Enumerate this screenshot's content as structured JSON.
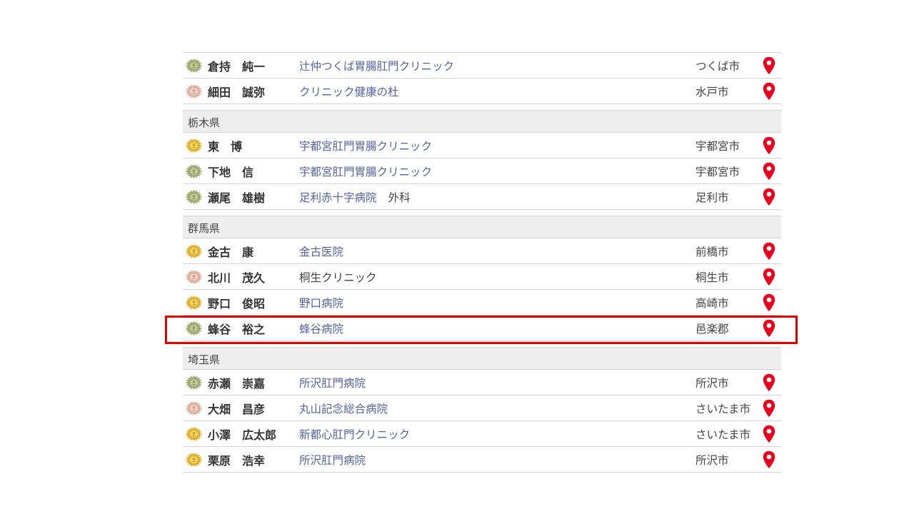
{
  "colors": {
    "link": "#5560a8",
    "text": "#333333",
    "section_bg": "#eeeeee",
    "pin": "#e8001c",
    "highlight_border": "#e00000",
    "badge_gold": "#e8b93c",
    "badge_olive": "#a8b07a",
    "badge_pink": "#e5b9a8"
  },
  "icons": {
    "badge": "member-seal-icon",
    "pin": "map-pin-icon"
  },
  "list": [
    {
      "type": "row",
      "badge": "olive",
      "name": "倉持　純一",
      "clinic": "辻仲つくば胃腸肛門クリニック",
      "clinic_link": true,
      "dept": "",
      "city": "つくば市"
    },
    {
      "type": "row",
      "badge": "pink",
      "name": "細田　誠弥",
      "clinic": "クリニック健康の杜",
      "clinic_link": true,
      "dept": "",
      "city": "水戸市"
    },
    {
      "type": "section",
      "label": "栃木県"
    },
    {
      "type": "row",
      "badge": "gold",
      "name": "東　博",
      "clinic": "宇都宮肛門胃腸クリニック",
      "clinic_link": true,
      "dept": "",
      "city": "宇都宮市"
    },
    {
      "type": "row",
      "badge": "olive",
      "name": "下地　信",
      "clinic": "宇都宮肛門胃腸クリニック",
      "clinic_link": true,
      "dept": "",
      "city": "宇都宮市"
    },
    {
      "type": "row",
      "badge": "olive",
      "name": "瀬尾　雄樹",
      "clinic": "足利赤十字病院",
      "clinic_link": true,
      "dept": "外科",
      "city": "足利市"
    },
    {
      "type": "section",
      "label": "群馬県"
    },
    {
      "type": "row",
      "badge": "gold",
      "name": "金古　康",
      "clinic": "金古医院",
      "clinic_link": true,
      "dept": "",
      "city": "前橋市"
    },
    {
      "type": "row",
      "badge": "pink",
      "name": "北川　茂久",
      "clinic": "桐生クリニック",
      "clinic_link": false,
      "dept": "",
      "city": "桐生市"
    },
    {
      "type": "row",
      "badge": "gold",
      "name": "野口　俊昭",
      "clinic": "野口病院",
      "clinic_link": true,
      "dept": "",
      "city": "高崎市"
    },
    {
      "type": "row",
      "badge": "olive",
      "name": "蜂谷　裕之",
      "clinic": "蜂谷病院",
      "clinic_link": true,
      "dept": "",
      "city": "邑楽郡",
      "highlighted": true
    },
    {
      "type": "section",
      "label": "埼玉県"
    },
    {
      "type": "row",
      "badge": "olive",
      "name": "赤瀬　崇嘉",
      "clinic": "所沢肛門病院",
      "clinic_link": true,
      "dept": "",
      "city": "所沢市"
    },
    {
      "type": "row",
      "badge": "pink",
      "name": "大畑　昌彦",
      "clinic": "丸山記念総合病院",
      "clinic_link": true,
      "dept": "",
      "city": "さいたま市"
    },
    {
      "type": "row",
      "badge": "gold",
      "name": "小澤　広太郎",
      "clinic": "新都心肛門クリニック",
      "clinic_link": true,
      "dept": "",
      "city": "さいたま市"
    },
    {
      "type": "row",
      "badge": "gold",
      "name": "栗原　浩幸",
      "clinic": "所沢肛門病院",
      "clinic_link": true,
      "dept": "",
      "city": "所沢市"
    }
  ]
}
